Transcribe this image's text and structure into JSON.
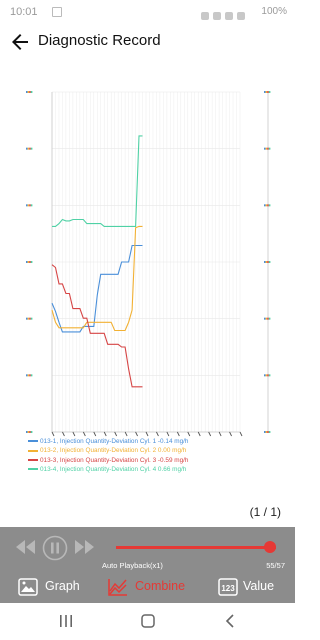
{
  "status_bar": {
    "time": "10:01",
    "battery": "100%"
  },
  "header": {
    "title": "Diagnostic Record"
  },
  "legend": [
    {
      "label": "013-1, Injection Quantity-Deviation Cyl. 1 -0.14 mg/h",
      "color": "#4a8fd9"
    },
    {
      "label": "013-2, Injection Quantity-Deviation Cyl. 2 0.00 mg/h",
      "color": "#f2b134"
    },
    {
      "label": "013-3, Injection Quantity-Deviation Cyl. 3 -0.59 mg/h",
      "color": "#d64545"
    },
    {
      "label": "013-4, Injection Quantity-Deviation Cyl. 4 0.66 mg/h",
      "color": "#4fd1a5"
    }
  ],
  "chart_data": {
    "type": "line",
    "x": [
      0,
      1,
      2,
      3,
      4,
      5,
      6,
      7,
      8,
      9,
      10,
      11,
      12,
      13,
      14,
      15,
      16,
      17,
      18,
      19,
      20,
      21,
      22,
      23,
      24,
      25,
      26,
      27,
      28,
      29,
      30,
      31,
      32,
      33,
      34,
      35,
      36,
      37,
      38,
      39,
      40,
      41,
      42,
      43,
      44,
      45,
      46,
      47,
      48,
      49,
      50,
      51,
      52,
      53,
      54
    ],
    "ylim": [
      -1.5,
      0.98
    ],
    "grid": true,
    "series": [
      {
        "name": "013-1, Injection Quantity-Deviation Cyl. 1",
        "color": "#4a8fd9",
        "values": [
          -0.56,
          -0.62,
          -0.7,
          -0.77,
          -0.77,
          -0.77,
          -0.77,
          -0.77,
          -0.77,
          -0.73,
          -0.73,
          -0.73,
          -0.73,
          -0.5,
          -0.35,
          -0.35,
          -0.35,
          -0.35,
          -0.35,
          -0.35,
          -0.26,
          -0.26,
          -0.26,
          -0.14,
          -0.14,
          -0.14,
          -0.14
        ]
      },
      {
        "name": "013-2, Injection Quantity-Deviation Cyl. 2",
        "color": "#f2b134",
        "values": [
          -0.61,
          -0.7,
          -0.74,
          -0.74,
          -0.74,
          -0.74,
          -0.74,
          -0.74,
          -0.74,
          -0.74,
          -0.7,
          -0.7,
          -0.7,
          -0.7,
          -0.7,
          -0.7,
          -0.7,
          -0.7,
          -0.76,
          -0.76,
          -0.76,
          -0.76,
          -0.7,
          -0.61,
          -0.01,
          0.0,
          0.0
        ]
      },
      {
        "name": "013-3, Injection Quantity-Deviation Cyl. 3",
        "color": "#d64545",
        "values": [
          -0.28,
          -0.3,
          -0.42,
          -0.42,
          -0.49,
          -0.49,
          -0.6,
          -0.6,
          -0.6,
          -0.67,
          -0.67,
          -0.78,
          -0.78,
          -0.78,
          -0.78,
          -0.78,
          -0.86,
          -0.86,
          -0.86,
          -0.86,
          -0.88,
          -0.88,
          -1.04,
          -1.17,
          -1.17,
          -1.17,
          -1.17
        ]
      },
      {
        "name": "013-4, Injection Quantity-Deviation Cyl. 4",
        "color": "#4fd1a5",
        "values": [
          0.0,
          0.0,
          0.02,
          0.05,
          0.04,
          0.04,
          0.05,
          0.05,
          0.05,
          0.05,
          0.02,
          0.02,
          0.02,
          0.02,
          0.02,
          0.0,
          0.0,
          0.0,
          0.0,
          0.0,
          0.0,
          0.0,
          0.0,
          0.0,
          0.0,
          0.66,
          0.66
        ]
      }
    ]
  },
  "chart_aux": {
    "y_tick_count": 7,
    "x_tick_count": 55
  },
  "pager": {
    "text": "(1 / 1)"
  },
  "player": {
    "playback_label": "Auto Playback(x1)",
    "frame_counter": "55/57",
    "progress": 0.965
  },
  "tabs": {
    "graph": "Graph",
    "combine": "Combine",
    "value": "Value"
  },
  "icons": {
    "back": "arrow-back-icon",
    "prev": "rewind-icon",
    "pause": "pause-icon",
    "next": "fast-forward-icon",
    "graph": "image-icon",
    "combine": "multi-line-chart-icon",
    "value": "numeric-icon"
  },
  "colors": {
    "accent": "#e53935",
    "player_bg": "#8c8c8c"
  }
}
